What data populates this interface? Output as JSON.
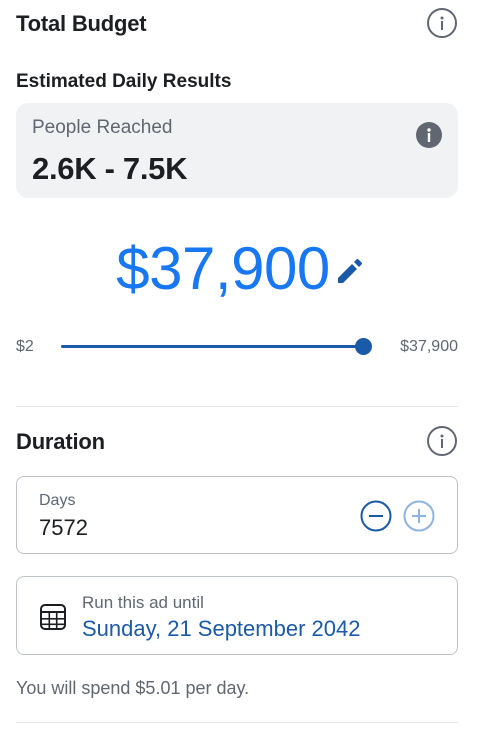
{
  "budget": {
    "title": "Total Budget",
    "info_icon": "info-outline-icon",
    "estimated_title": "Estimated Daily Results",
    "reach": {
      "label": "People Reached",
      "value": "2.6K - 7.5K",
      "info_icon": "info-filled-icon"
    },
    "amount": "$37,900",
    "edit_icon": "pencil-icon",
    "slider": {
      "min_label": "$2",
      "max_label": "$37,900",
      "fill_fraction": 1.0
    }
  },
  "duration": {
    "title": "Duration",
    "info_icon": "info-outline-icon",
    "days": {
      "label": "Days",
      "value": "7572",
      "decrement_icon": "minus-circle-icon",
      "increment_icon": "plus-circle-icon"
    },
    "run_until": {
      "icon": "calendar-icon",
      "label": "Run this ad until",
      "date": "Sunday, 21 September 2042"
    },
    "spend_text": "You will spend $5.01 per day."
  },
  "colors": {
    "accent": "#1877f2",
    "accent_dark": "#1b5aa8",
    "text_primary": "#1c1e21",
    "text_secondary": "#606770",
    "card_bg": "#f1f2f4",
    "border": "#bec3c9"
  }
}
